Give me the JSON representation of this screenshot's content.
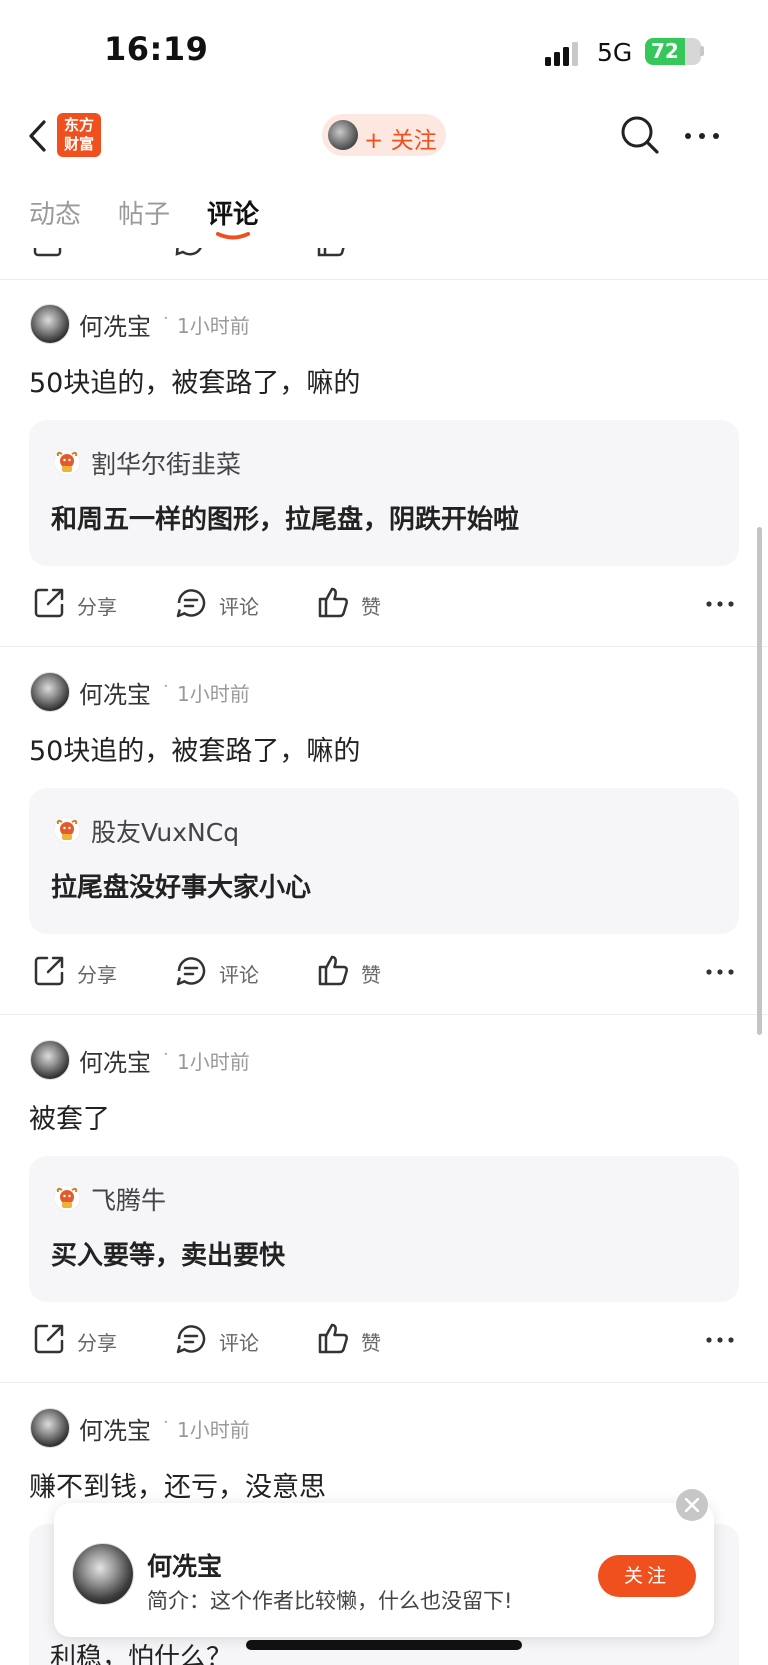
{
  "status_bar": {
    "time": "16:19",
    "network": "5G",
    "battery": "72",
    "battery_level": 0.72
  },
  "nav": {
    "logo_line1": "东方",
    "logo_line2": "财富",
    "follow_label": "+ 关注"
  },
  "tabs": [
    {
      "label": "动态",
      "active": false
    },
    {
      "label": "帖子",
      "active": false
    },
    {
      "label": "评论",
      "active": true
    }
  ],
  "actions": {
    "share": "分享",
    "comment": "评论",
    "like": "赞"
  },
  "posts": [
    {
      "username": "何冼宝",
      "time": "1小时前",
      "text": "50块追的，被套路了，嘛的",
      "quote_user": "割华尔街韭菜",
      "quote_text": "和周五一样的图形，拉尾盘，阴跌开始啦"
    },
    {
      "username": "何冼宝",
      "time": "1小时前",
      "text": "50块追的，被套路了，嘛的",
      "quote_user": "股友VuxNCq",
      "quote_text": "拉尾盘没好事大家小心"
    },
    {
      "username": "何冼宝",
      "time": "1小时前",
      "text": "被套了",
      "quote_user": "飞腾牛",
      "quote_text": "买入要等，卖出要快"
    },
    {
      "username": "何冼宝",
      "time": "1小时前",
      "text": "赚不到钱，还亏，没意思"
    }
  ],
  "profile_card": {
    "name": "何冼宝",
    "bio": "简介：这个作者比较懒，什么也没留下!",
    "follow_label": "关注"
  },
  "behind_text": "利稳，怕什么？"
}
